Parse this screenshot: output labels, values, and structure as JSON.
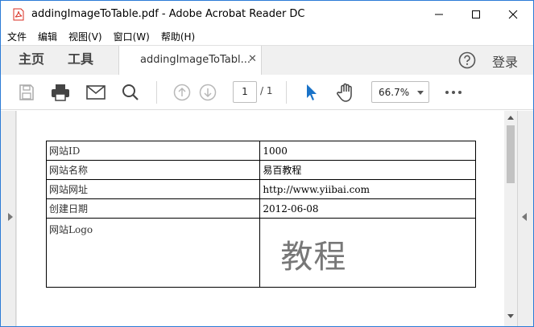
{
  "window": {
    "title": "addingImageToTable.pdf - Adobe Acrobat Reader DC"
  },
  "menu": [
    "文件",
    "编辑",
    "视图(V)",
    "窗口(W)",
    "帮助(H)"
  ],
  "tabs": {
    "home": "主页",
    "tools": "工具",
    "document": "addingImageToTabl...",
    "signin": "登录"
  },
  "toolbar": {
    "page_current": "1",
    "page_total": "/ 1",
    "zoom": "66.7%"
  },
  "colors": {
    "accent_blue": "#2b7bd6",
    "pdf_red": "#d82c20",
    "select_tool_blue": "#1a73c8"
  },
  "table": {
    "rows": [
      {
        "label": "网站ID",
        "value": "1000"
      },
      {
        "label": "网站名称",
        "value": "易百教程"
      },
      {
        "label": "网站网址",
        "value": "http://www.yiibai.com"
      },
      {
        "label": "创建日期",
        "value": "2012-06-08"
      }
    ],
    "logo_label": "网站Logo",
    "logo_text": "教程"
  }
}
